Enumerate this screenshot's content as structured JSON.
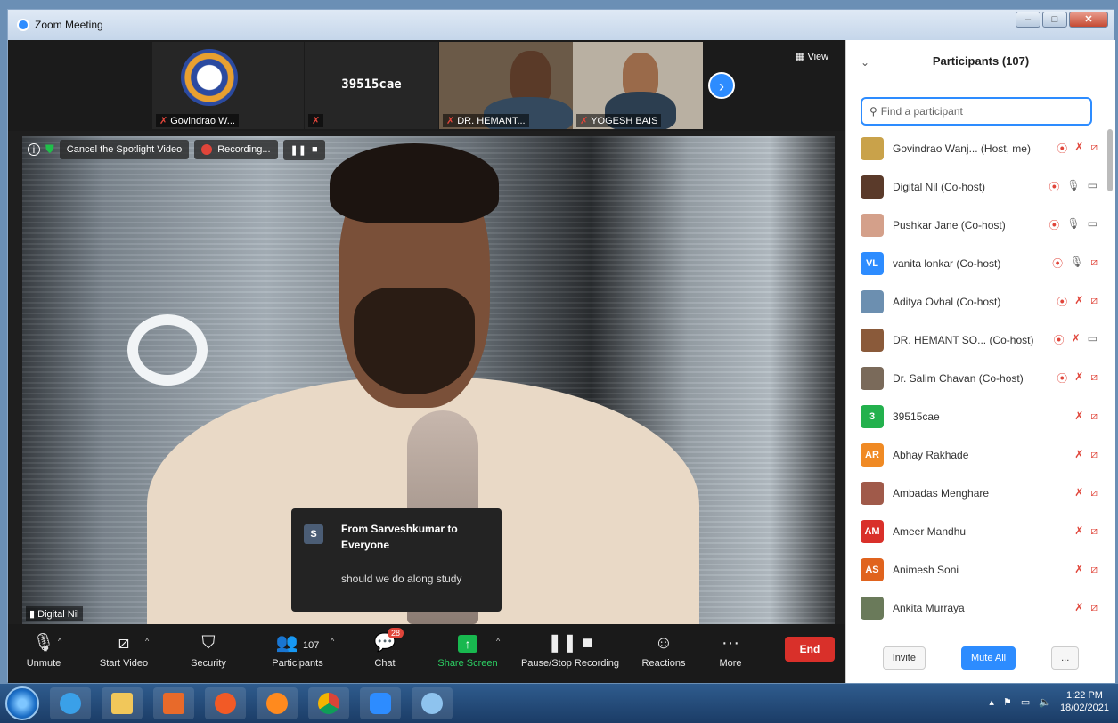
{
  "window": {
    "title": "Zoom Meeting"
  },
  "thumbnails": [
    {
      "name": "Govindrao W..."
    },
    {
      "name": "",
      "center_name": "39515cae"
    },
    {
      "name": "DR. HEMANT..."
    },
    {
      "name": "YOGESH BAIS"
    }
  ],
  "view_label": "View",
  "video_toolbar": {
    "spotlight": "Cancel the Spotlight Video",
    "recording": "Recording..."
  },
  "speaker_name": "Digital Nil",
  "chat_popup": {
    "avatar": "S",
    "from": "From Sarveshkumar to Everyone",
    "message": "should we do along study"
  },
  "controls": {
    "unmute": "Unmute",
    "start_video": "Start Video",
    "security": "Security",
    "participants": "Participants",
    "participants_count": "107",
    "chat": "Chat",
    "chat_badge": "28",
    "share_screen": "Share Screen",
    "pause_recording": "Pause/Stop Recording",
    "reactions": "Reactions",
    "more": "More",
    "end": "End"
  },
  "participants_panel": {
    "title": "Participants (107)",
    "search_placeholder": "Find a participant",
    "items": [
      {
        "name": "Govindrao Wanj...  (Host, me)",
        "avatar": "",
        "color": "#c9a24a"
      },
      {
        "name": "Digital Nil (Co-host)",
        "avatar": "",
        "color": "#5a3a2a"
      },
      {
        "name": "Pushkar Jane (Co-host)",
        "avatar": "",
        "color": "#d4a08a"
      },
      {
        "name": "vanita lonkar (Co-host)",
        "avatar": "VL",
        "color": "#2d8cff"
      },
      {
        "name": "Aditya Ovhal (Co-host)",
        "avatar": "",
        "color": "#6c8fb0"
      },
      {
        "name": "DR. HEMANT SO...  (Co-host)",
        "avatar": "",
        "color": "#8a5a3a"
      },
      {
        "name": "Dr. Salim Chavan (Co-host)",
        "avatar": "",
        "color": "#7a6a5a"
      },
      {
        "name": "39515cae",
        "avatar": "3",
        "color": "#23b14d"
      },
      {
        "name": "Abhay Rakhade",
        "avatar": "AR",
        "color": "#f08a24"
      },
      {
        "name": "Ambadas Menghare",
        "avatar": "",
        "color": "#a05a4a"
      },
      {
        "name": "Ameer Mandhu",
        "avatar": "AM",
        "color": "#d9302a"
      },
      {
        "name": "Animesh Soni",
        "avatar": "AS",
        "color": "#e0631e"
      },
      {
        "name": "Ankita Murraya",
        "avatar": "",
        "color": "#6a7a5a"
      }
    ],
    "invite": "Invite",
    "mute_all": "Mute All",
    "more": "..."
  },
  "taskbar": {
    "time": "1:22 PM",
    "date": "18/02/2021"
  }
}
